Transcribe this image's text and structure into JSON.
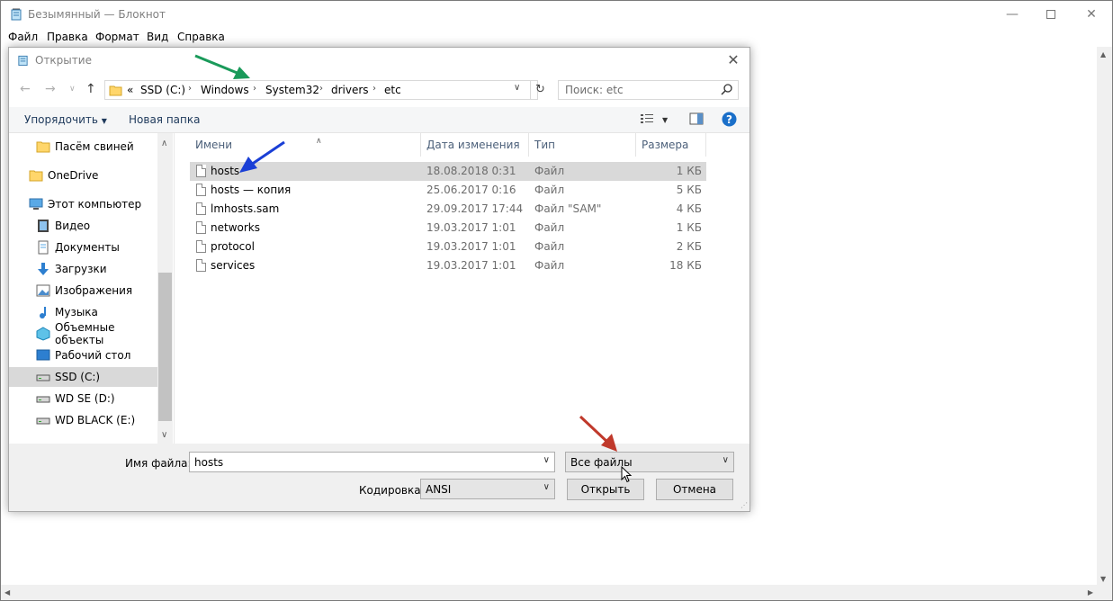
{
  "notepad": {
    "title": "Безымянный — Блокнот",
    "menu": [
      "Файл",
      "Правка",
      "Формат",
      "Вид",
      "Справка"
    ]
  },
  "dialog": {
    "title": "Открытие",
    "breadcrumb": {
      "prefix": "«",
      "parts": [
        "SSD  (C:)",
        "Windows",
        "System32",
        "drivers",
        "etc"
      ]
    },
    "search_placeholder": "Поиск: etc",
    "toolbar": {
      "organize": "Упорядочить",
      "new_folder": "Новая папка"
    },
    "nav": [
      {
        "label": "Пасём свиней",
        "icon": "folder-icon",
        "selected": false
      },
      {
        "label": "OneDrive",
        "icon": "folder-icon",
        "selected": false
      },
      {
        "label": "Этот компьютер",
        "icon": "computer-icon",
        "selected": false
      },
      {
        "label": "Видео",
        "icon": "video-icon",
        "selected": false
      },
      {
        "label": "Документы",
        "icon": "documents-icon",
        "selected": false
      },
      {
        "label": "Загрузки",
        "icon": "download-icon",
        "selected": false
      },
      {
        "label": "Изображения",
        "icon": "pictures-icon",
        "selected": false
      },
      {
        "label": "Музыка",
        "icon": "music-icon",
        "selected": false
      },
      {
        "label": "Объемные объекты",
        "icon": "3d-objects-icon",
        "selected": false
      },
      {
        "label": "Рабочий стол",
        "icon": "desktop-icon",
        "selected": false
      },
      {
        "label": "SSD  (C:)",
        "icon": "drive-icon",
        "selected": true
      },
      {
        "label": "WD SE (D:)",
        "icon": "drive-icon",
        "selected": false
      },
      {
        "label": "WD BLACK (E:)",
        "icon": "drive-icon",
        "selected": false
      }
    ],
    "columns": [
      "Имени",
      "Дата изменения",
      "Тип",
      "Размера"
    ],
    "files": [
      {
        "name": "hosts",
        "date": "18.08.2018 0:31",
        "type": "Файл",
        "size": "1 КБ",
        "selected": true
      },
      {
        "name": "hosts — копия",
        "date": "25.06.2017 0:16",
        "type": "Файл",
        "size": "5 КБ",
        "selected": false
      },
      {
        "name": "lmhosts.sam",
        "date": "29.09.2017 17:44",
        "type": "Файл \"SAM\"",
        "size": "4 КБ",
        "selected": false
      },
      {
        "name": "networks",
        "date": "19.03.2017 1:01",
        "type": "Файл",
        "size": "1 КБ",
        "selected": false
      },
      {
        "name": "protocol",
        "date": "19.03.2017 1:01",
        "type": "Файл",
        "size": "2 КБ",
        "selected": false
      },
      {
        "name": "services",
        "date": "19.03.2017 1:01",
        "type": "Файл",
        "size": "18 КБ",
        "selected": false
      }
    ],
    "bottom": {
      "filename_label": "Имя файла:",
      "filename_value": "hosts",
      "filetype_value": "Все файлы",
      "encoding_label": "Кодировка:",
      "encoding_value": "ANSI",
      "open_label": "Открыть",
      "cancel_label": "Отмена"
    }
  },
  "colors": {
    "annotation_green": "#1a9a5a",
    "annotation_blue": "#1a3fd6",
    "annotation_red": "#c0392b",
    "selection_gray": "#d9d9d9",
    "help_blue": "#1a6fc9"
  }
}
